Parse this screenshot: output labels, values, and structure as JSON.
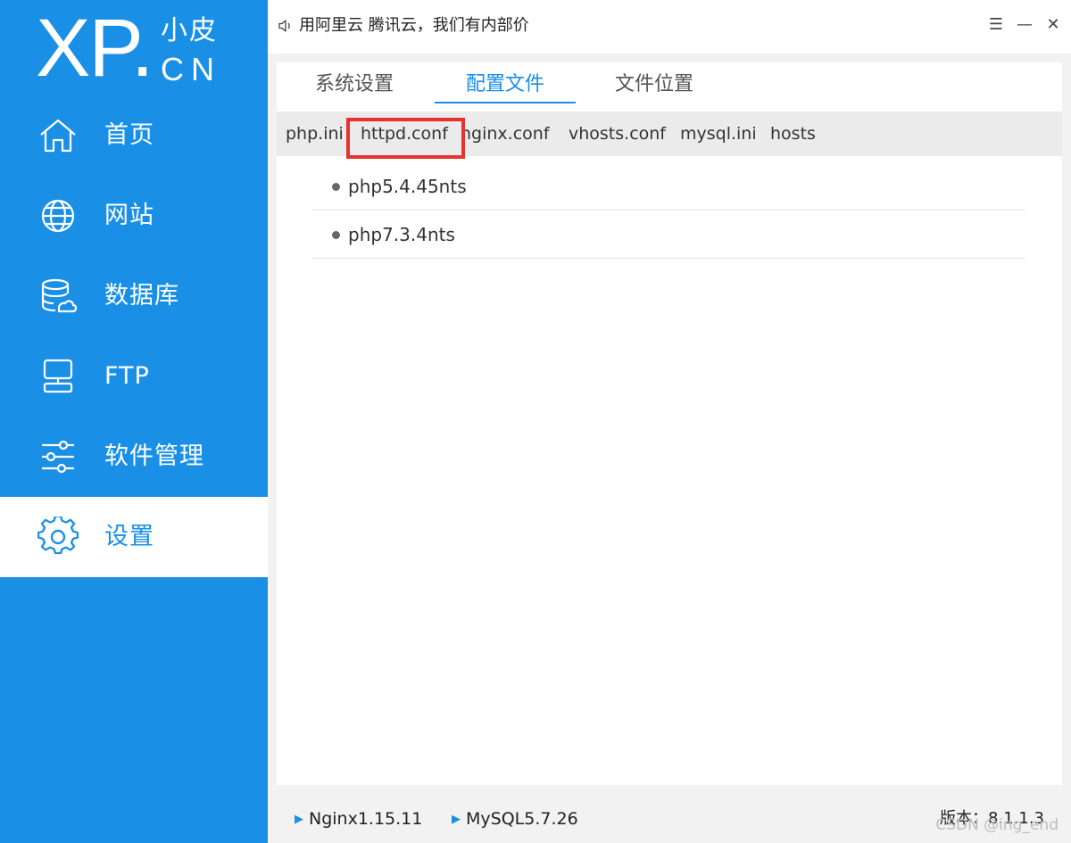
{
  "logo": {
    "main": "XP.",
    "cn_top": "小皮",
    "cn_bottom": "CN"
  },
  "sidebar": {
    "items": [
      {
        "label": "首页",
        "icon": "home-icon"
      },
      {
        "label": "网站",
        "icon": "globe-icon"
      },
      {
        "label": "数据库",
        "icon": "database-icon"
      },
      {
        "label": "FTP",
        "icon": "server-icon"
      },
      {
        "label": "软件管理",
        "icon": "sliders-icon"
      },
      {
        "label": "设置",
        "icon": "gear-icon",
        "active": true
      }
    ]
  },
  "titlebar": {
    "text": "用阿里云 腾讯云，我们有内部价",
    "menu": "☰",
    "minimize": "—",
    "close": "✕"
  },
  "tabs": [
    {
      "label": "系统设置"
    },
    {
      "label": "配置文件",
      "active": true
    },
    {
      "label": "文件位置"
    }
  ],
  "subtabs": [
    {
      "label": "php.ini"
    },
    {
      "label": "httpd.conf",
      "highlighted": true
    },
    {
      "label": "nginx.conf"
    },
    {
      "label": "vhosts.conf"
    },
    {
      "label": "mysql.ini"
    },
    {
      "label": "hosts"
    }
  ],
  "list": [
    {
      "label": "php5.4.45nts"
    },
    {
      "label": "php7.3.4nts"
    }
  ],
  "statusbar": {
    "services": [
      {
        "label": "Nginx1.15.11"
      },
      {
        "label": "MySQL5.7.26"
      }
    ],
    "version_label": "版本：",
    "version": "8.1.1.3",
    "watermark": "CSDN @ing_end"
  },
  "colors": {
    "accent": "#1a8fe6",
    "highlight": "#e8322f"
  }
}
